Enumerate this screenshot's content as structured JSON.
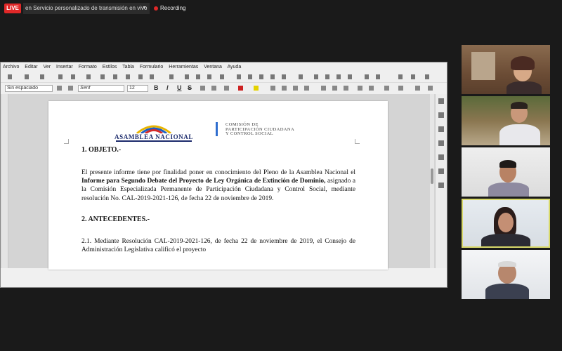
{
  "stream": {
    "live_badge": "LIVE",
    "service": "en Servicio personalizado de transmisión en vivo",
    "recording": "Recording"
  },
  "writer": {
    "menu": [
      "Archivo",
      "Editar",
      "Ver",
      "Insertar",
      "Formato",
      "Estilos",
      "Tabla",
      "Formulario",
      "Herramientas",
      "Ventana",
      "Ayuda"
    ],
    "paragraph_style": "Sin espaciado",
    "font_name": "Serif",
    "font_size": "12",
    "format_buttons": {
      "bold": "B",
      "italic": "I",
      "underline": "U",
      "strike": "S"
    }
  },
  "document": {
    "logo_left_name": "ASAMBLEA NACIONAL",
    "logo_right_lines": [
      "COMISIÓN DE",
      "PARTICIPACIÓN CIUDADANA",
      "Y CONTROL SOCIAL"
    ],
    "heading1": "1. OBJETO.-",
    "para1_a": "El presente informe tiene por finalidad poner en conocimiento del Pleno de la Asamblea Nacional el ",
    "para1_bold": "Informe para Segundo Debate del Proyecto de Ley Orgánica de Extinción de Dominio,",
    "para1_b": " asignado a la Comisión Especializada Permanente de Participación Ciudadana y Control Social, mediante resolución No. CAL-2019-2021-126, de fecha 22 de noviembre de 2019.",
    "heading2": "2. ANTECEDENTES.-",
    "para2": "2.1. Mediante Resolución CAL-2019-2021-126, de fecha 22 de noviembre de 2019, el Consejo de Administración Legislativa calificó el proyecto"
  },
  "colors": {
    "live": "#e02828",
    "accent_blue": "#2f6ecf",
    "active_speaker_border": "#d8d96a"
  }
}
